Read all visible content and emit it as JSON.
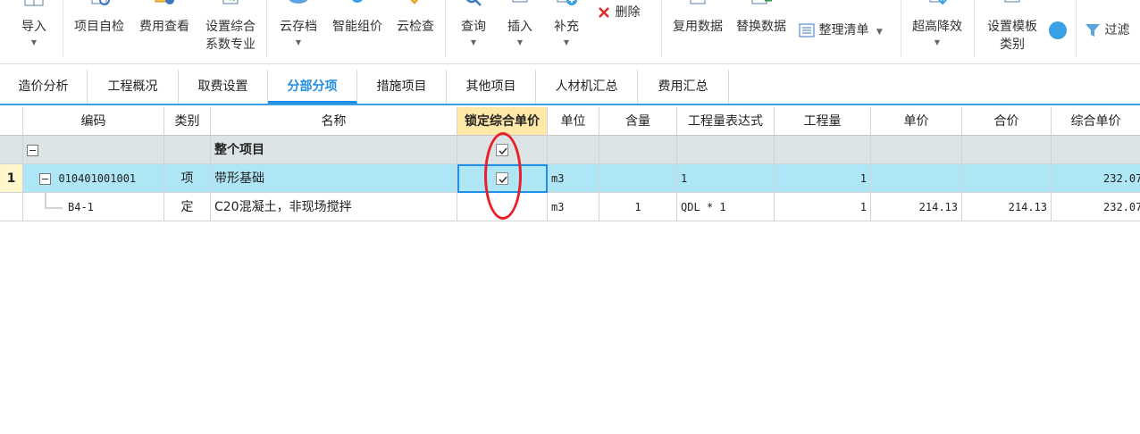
{
  "ribbon": {
    "import": "导入",
    "self_check": "项目自检",
    "fee_view": "费用查看",
    "set_coef_line1": "设置综合",
    "set_coef_line2": "系数专业",
    "cloud_store": "云存档",
    "smart_price": "智能组价",
    "cloud_check": "云检查",
    "query": "查询",
    "insert": "插入",
    "supplement": "补充",
    "delete": "删除",
    "reuse_data": "复用数据",
    "replace_data": "替换数据",
    "organize_list": "整理清单",
    "height_reduce": "超高降效",
    "set_template_line1": "设置模板",
    "set_template_line2": "类别",
    "filter": "过滤"
  },
  "tabs": [
    "造价分析",
    "工程概况",
    "取费设置",
    "分部分项",
    "措施项目",
    "其他项目",
    "人材机汇总",
    "费用汇总"
  ],
  "active_tab": "分部分项",
  "table": {
    "headers": {
      "code": "编码",
      "type": "类别",
      "name": "名称",
      "lock": "锁定综合单价",
      "unit": "单位",
      "content": "含量",
      "expr": "工程量表达式",
      "qty": "工程量",
      "price": "单价",
      "total": "合价",
      "comp": "综合单价"
    },
    "rows": [
      {
        "rownum": "",
        "code": "",
        "type": "",
        "name": "整个项目",
        "locked": true,
        "unit": "",
        "content": "",
        "expr": "",
        "qty": "",
        "price": "",
        "total": "",
        "comp": ""
      },
      {
        "rownum": "1",
        "code": "010401001001",
        "type": "项",
        "name": "带形基础",
        "locked": true,
        "unit": "m3",
        "content": "",
        "expr": "1",
        "qty": "1",
        "price": "",
        "total": "",
        "comp": "232.07"
      },
      {
        "rownum": "",
        "code": "B4-1",
        "type": "定",
        "name": "C20混凝土，非现场搅拌",
        "locked": false,
        "unit": "m3",
        "content": "1",
        "expr": "QDL * 1",
        "qty": "1",
        "price": "214.13",
        "total": "214.13",
        "comp": "232.07"
      }
    ]
  },
  "colors": {
    "accent": "#1f8ee6",
    "lock_header": "#ffe9a8",
    "selected_row": "#aee6f6",
    "summary_row": "#dce4e6",
    "annotation": "#e8202a"
  }
}
